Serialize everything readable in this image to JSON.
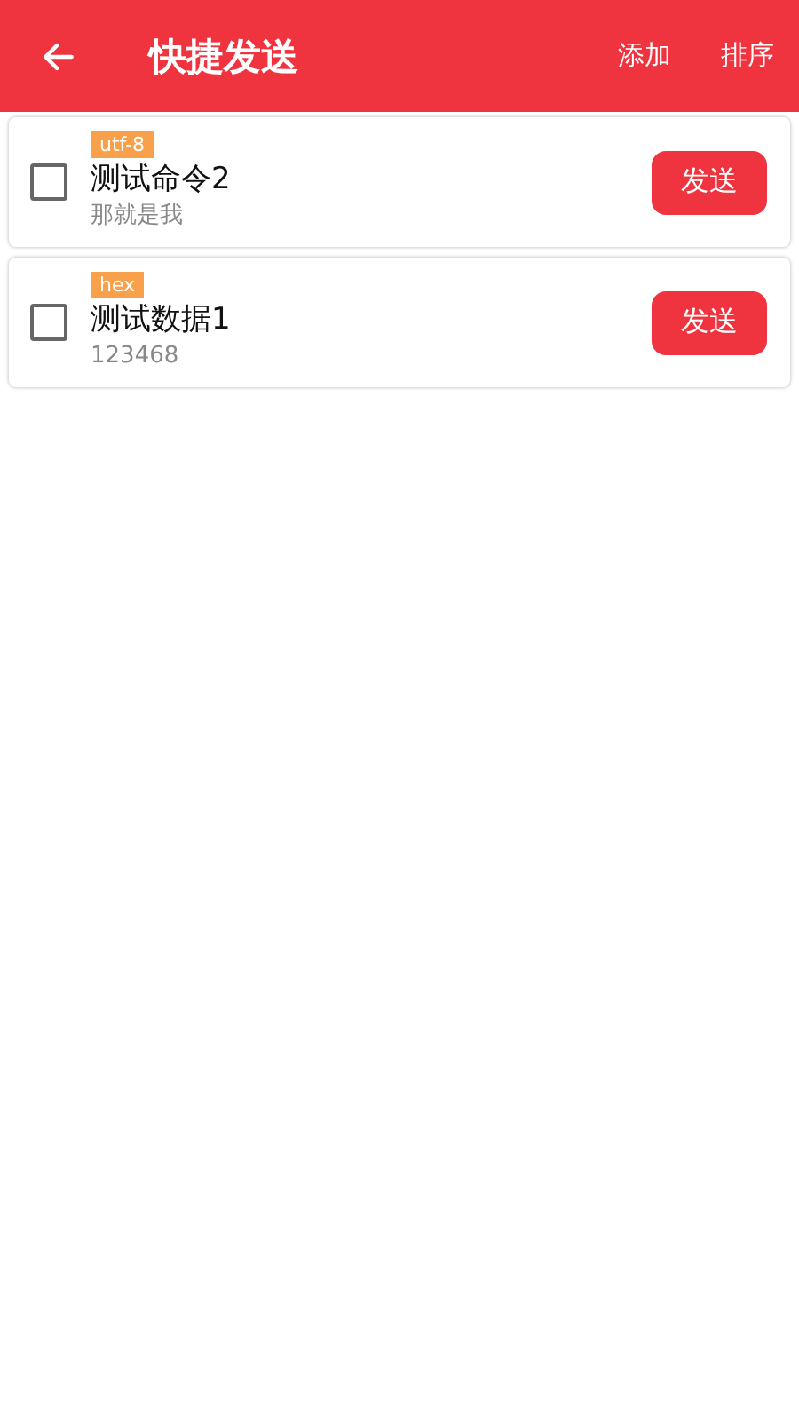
{
  "toolbar": {
    "title": "快捷发送",
    "actions": [
      "添加",
      "排序"
    ]
  },
  "items": [
    {
      "encoding": "utf-8",
      "name": "测试命令2",
      "content": "那就是我",
      "checked": false,
      "button": "发送"
    },
    {
      "encoding": "hex",
      "name": "测试数据1",
      "content": "123468",
      "checked": false,
      "button": "发送"
    }
  ]
}
